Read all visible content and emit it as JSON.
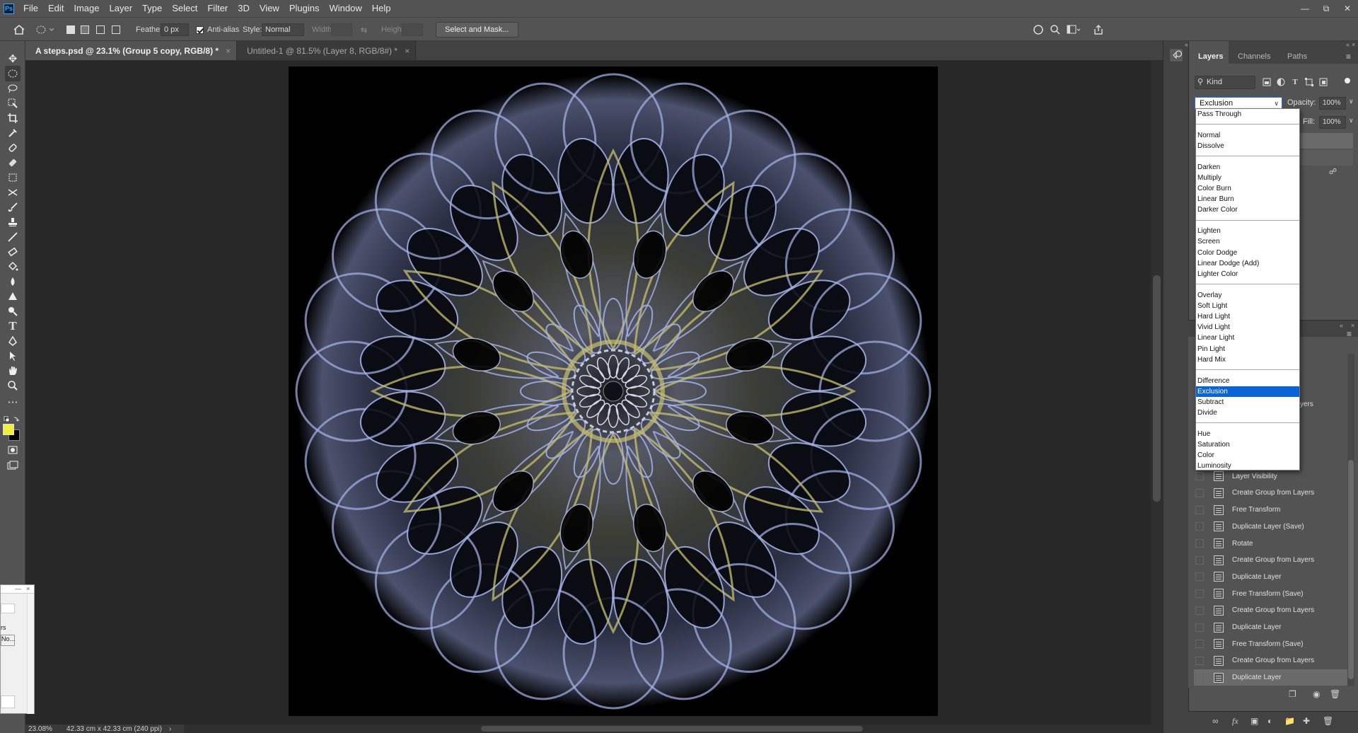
{
  "menubar": {
    "logo": "Ps",
    "items": [
      "File",
      "Edit",
      "Image",
      "Layer",
      "Type",
      "Select",
      "Filter",
      "3D",
      "View",
      "Plugins",
      "Window",
      "Help"
    ]
  },
  "options": {
    "feather_label": "Feather:",
    "feather_value": "0 px",
    "antialias_label": "Anti-alias",
    "style_label": "Style:",
    "style_value": "Normal",
    "width_label": "Width:",
    "height_label": "Height:",
    "select_mask_label": "Select and Mask..."
  },
  "tabs": [
    {
      "label": "A steps.psd @ 23.1% (Group 5 copy, RGB/8) *",
      "active": true
    },
    {
      "label": "Untitled-1 @ 81.5% (Layer 8, RGB/8#) *",
      "active": false
    }
  ],
  "status": {
    "zoom": "23.08%",
    "doc_info": "42.33 cm x 42.33 cm (240 ppi)"
  },
  "layers_panel": {
    "tabs": [
      "Layers",
      "Channels",
      "Paths"
    ],
    "kind_filter": "Kind",
    "blend_mode": "Exclusion",
    "opacity_label": "Opacity:",
    "opacity_value": "100%",
    "fill_label": "Fill:",
    "fill_value": "100%"
  },
  "blend_dropdown": {
    "groups": [
      [
        "Pass Through"
      ],
      [
        "Normal",
        "Dissolve"
      ],
      [
        "Darken",
        "Multiply",
        "Color Burn",
        "Linear Burn",
        "Darker Color"
      ],
      [
        "Lighten",
        "Screen",
        "Color Dodge",
        "Linear Dodge (Add)",
        "Lighter Color"
      ],
      [
        "Overlay",
        "Soft Light",
        "Hard Light",
        "Vivid Light",
        "Linear Light",
        "Pin Light",
        "Hard Mix"
      ],
      [
        "Difference",
        "Exclusion",
        "Subtract",
        "Divide"
      ],
      [
        "Hue",
        "Saturation",
        "Color",
        "Luminosity"
      ]
    ],
    "selected": "Exclusion"
  },
  "history": {
    "partial_behind": "yers",
    "items": [
      "Layer Visibility",
      "Layer Visibility",
      "Create Group from Layers",
      "Free Transform",
      "Duplicate Layer (Save)",
      "Rotate",
      "Create Group from Layers",
      "Duplicate Layer",
      "Free Transform (Save)",
      "Create Group from Layers",
      "Duplicate Layer",
      "Free Transform (Save)",
      "Create Group from Layers",
      "Duplicate Layer"
    ]
  },
  "mini_dialog": {
    "line1": "rs",
    "line2": "No..."
  },
  "colors": {
    "foreground": "#f0f03c",
    "background": "#000000",
    "selection": "#0a64d8",
    "accent_yellow": "#c8c070",
    "mandala_blue": "#a6b4e8"
  },
  "icons": [
    "home-icon",
    "ellipse-marquee-icon",
    "move-icon",
    "lasso-icon",
    "crop-icon",
    "brush-icon",
    "type-icon",
    "hand-icon",
    "zoom-icon",
    "search-icon",
    "share-icon"
  ]
}
